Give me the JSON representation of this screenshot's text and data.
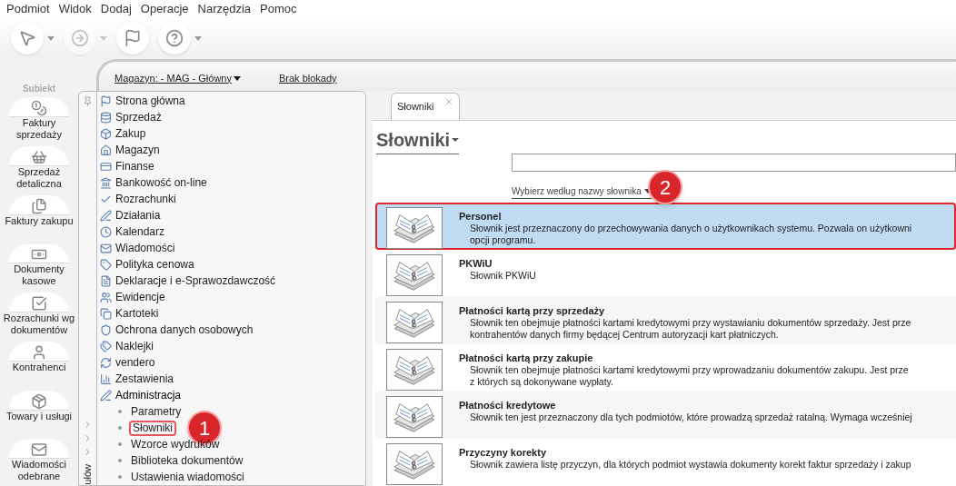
{
  "menu": [
    "Podmiot",
    "Widok",
    "Dodaj",
    "Operacje",
    "Narzędzia",
    "Pomoc"
  ],
  "toolbar": [
    {
      "has_caret": true,
      "disabled": false
    },
    {
      "has_caret": true,
      "disabled": true
    },
    {
      "has_caret": false,
      "disabled": false
    },
    {
      "has_caret": true,
      "disabled": false
    }
  ],
  "logo": {
    "caption": "Subiekt"
  },
  "sidebar": {
    "items": [
      "Faktury sprzedaży",
      "Sprzedaż detaliczna",
      "Faktury zakupu",
      "Dokumenty kasowe",
      "Rozrachunki wg dokumentów",
      "Kontrahenci",
      "Towary i usługi",
      "Wiadomości odebrane"
    ]
  },
  "header": {
    "warehouse_link": "Magazyn: - MAG - Główny",
    "lock_link": "Brak blokady"
  },
  "nav": {
    "gutter_label": "ułów",
    "items": [
      {
        "label": "Strona główna",
        "expanded": false
      },
      {
        "label": "Sprzedaż",
        "expanded": false
      },
      {
        "label": "Zakup",
        "expanded": false
      },
      {
        "label": "Magazyn",
        "expanded": false
      },
      {
        "label": "Finanse",
        "expanded": false
      },
      {
        "label": "Bankowość on-line",
        "expanded": false
      },
      {
        "label": "Rozrachunki",
        "expanded": false
      },
      {
        "label": "Działania",
        "expanded": false
      },
      {
        "label": "Kalendarz",
        "expanded": false
      },
      {
        "label": "Wiadomości",
        "expanded": false
      },
      {
        "label": "Polityka cenowa",
        "expanded": false
      },
      {
        "label": "Deklaracje i e-Sprawozdawczość",
        "expanded": false
      },
      {
        "label": "Ewidencje",
        "expanded": false
      },
      {
        "label": "Kartoteki",
        "expanded": false
      },
      {
        "label": "Ochrona danych osobowych",
        "expanded": false
      },
      {
        "label": "Naklejki",
        "expanded": false
      },
      {
        "label": "vendero",
        "expanded": false
      },
      {
        "label": "Zestawienia",
        "expanded": false
      },
      {
        "label": "Administracja",
        "expanded": true,
        "children": [
          {
            "label": "Parametry",
            "annotated": false
          },
          {
            "label": "Słowniki",
            "annotated": true,
            "callout": "1"
          },
          {
            "label": "Wzorce wydruków",
            "annotated": false
          },
          {
            "label": "Biblioteka dokumentów",
            "annotated": false
          },
          {
            "label": "Ustawienia wiadomości",
            "annotated": false
          }
        ]
      }
    ]
  },
  "tab": {
    "label": "Słowniki",
    "selected": true
  },
  "page_title": "Słowniki",
  "search": {
    "filter_label": "Wybierz według nazwy słownika",
    "callout": "2"
  },
  "dictionaries": [
    {
      "name": "Personel",
      "description": "Słownik jest przeznaczony do przechowywania danych o użytkownikach systemu. Pozwala on użytkowni",
      "description_2": "opcji programu.",
      "selected": true,
      "annotated": true
    },
    {
      "name": "PKWiU",
      "description": "Słownik PKWiU",
      "selected": false,
      "annotated": false
    },
    {
      "name": "Płatności kartą przy sprzedaży",
      "description": "Słownik ten obejmuje płatności kartami kredytowymi przy wystawianiu dokumentów sprzedaży. Jest prze",
      "description_2": "kontrahentów danych firmy będącej Centrum autoryzacji kart płatniczych.",
      "selected": false,
      "annotated": false
    },
    {
      "name": "Płatności kartą przy zakupie",
      "description": "Słownik ten obejmuje płatności kartami kredytowymi przy wprowadzaniu dokumentów zakupu. Jest prze",
      "description_2": "z których są dokonywane wypłaty.",
      "selected": false,
      "annotated": false
    },
    {
      "name": "Płatności kredytowe",
      "description": "Słownik ten jest przeznaczony dla tych podmiotów, które prowadzą sprzedaż ratalną. Wymaga wcześniej",
      "selected": false,
      "annotated": false
    },
    {
      "name": "Przyczyny korekty",
      "description": "Słownik zawiera listę przyczyn, dla których podmiot wystawia dokumenty korekt faktur sprzedaży i zakup",
      "selected": false,
      "annotated": false
    }
  ]
}
